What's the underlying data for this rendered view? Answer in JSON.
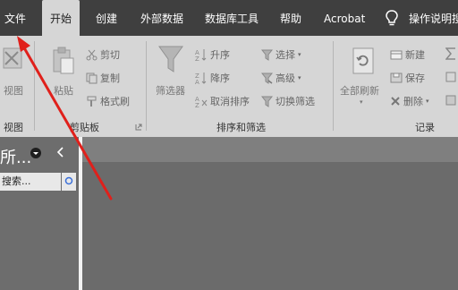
{
  "menu": {
    "tabs": [
      "文件",
      "开始",
      "创建",
      "外部数据",
      "数据库工具",
      "帮助",
      "Acrobat"
    ],
    "help_search": "操作说明搜"
  },
  "ribbon": {
    "view": {
      "button": "视图",
      "group": "视图"
    },
    "clipboard": {
      "paste": "粘贴",
      "cut": "剪切",
      "copy": "复制",
      "format_painter": "格式刷",
      "group": "剪贴板"
    },
    "sort_filter": {
      "filter": "筛选器",
      "ascending": "升序",
      "descending": "降序",
      "clear_sort": "取消排序",
      "selection": "选择",
      "advanced": "高级",
      "toggle_filter": "切换筛选",
      "group": "排序和筛选"
    },
    "records": {
      "refresh_all": "全部刷新",
      "new": "新建",
      "save": "保存",
      "delete": "删除",
      "group": "记录"
    }
  },
  "nav_pane": {
    "title": "所...",
    "search_placeholder": "搜索..."
  },
  "colors": {
    "menubar": "#3f3f3f",
    "ribbon": "#d6d6d6",
    "workspace": "#6b6b6b",
    "annotation_arrow": "#e0201b"
  }
}
